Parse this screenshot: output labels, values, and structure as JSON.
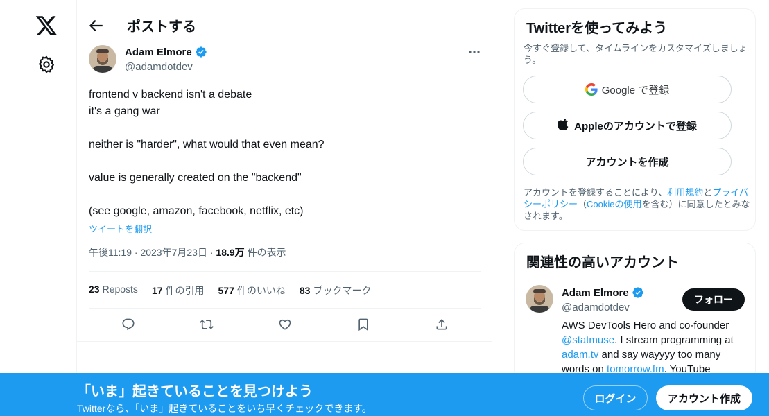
{
  "main": {
    "title": "ポストする",
    "tweet": {
      "author_name": "Adam Elmore",
      "author_handle": "@adamdotdev",
      "lines": [
        "frontend v backend isn't a debate\nit's a gang war",
        "neither is \"harder\", what would that even mean?",
        "value is generally created on the \"backend\"",
        "(see google, amazon, facebook, netflix, etc)"
      ],
      "translate_label": "ツイートを翻訳",
      "time": "午後11:19",
      "date": "2023年7月23日",
      "views_count": "18.9万",
      "views_label": "件の表示",
      "stats": {
        "reposts_count": "23",
        "reposts_label": "Reposts",
        "quotes_count": "17",
        "quotes_label": "件の引用",
        "likes_count": "577",
        "likes_label": "件のいいね",
        "bookmarks_count": "83",
        "bookmarks_label": "ブックマーク"
      }
    }
  },
  "sidebar": {
    "signup_card": {
      "title": "Twitterを使ってみよう",
      "subtitle": "今すぐ登録して、タイムラインをカスタマイズしましょう。",
      "google_label": "Google で登録",
      "apple_label": "Appleのアカウントで登録",
      "create_label": "アカウントを作成",
      "terms_prefix": "アカウントを登録することにより、",
      "terms_link": "利用規約",
      "terms_and": "と",
      "privacy_link": "プライバシーポリシー",
      "terms_open": "（",
      "cookie_link": "Cookieの使用",
      "terms_suffix": "を含む）に同意したとみなされます。"
    },
    "related_card": {
      "title": "関連性の高いアカウント",
      "name": "Adam Elmore",
      "handle": "@adamdotdev",
      "follow_label": "フォロー",
      "bio_1": "AWS DevTools Hero and co-founder ",
      "bio_link1": "@statmuse",
      "bio_2": ". I stream programming at ",
      "bio_link2": "adam.tv",
      "bio_3": " and say wayyyy too many words on ",
      "bio_link3": "tomorrow.fm",
      "bio_4": ". YouTube"
    }
  },
  "banner": {
    "title": "「いま」起きていることを見つけよう",
    "subtitle": "Twitterなら、「いま」起きていることをいち早くチェックできます。",
    "login_label": "ログイン",
    "create_label": "アカウント作成"
  },
  "icons": {
    "logo": "x-logo-icon",
    "settings": "gear-icon",
    "back": "arrow-left-icon",
    "more": "more-dots-icon",
    "verified": "verified-badge-icon",
    "reply": "reply-icon",
    "repost": "repost-icon",
    "like": "heart-icon",
    "bookmark": "bookmark-icon",
    "share": "share-icon",
    "google": "google-icon",
    "apple": "apple-icon"
  },
  "colors": {
    "accent": "#1d9bf0",
    "text": "#0f1419",
    "muted": "#536471",
    "border": "#eff3f4"
  }
}
